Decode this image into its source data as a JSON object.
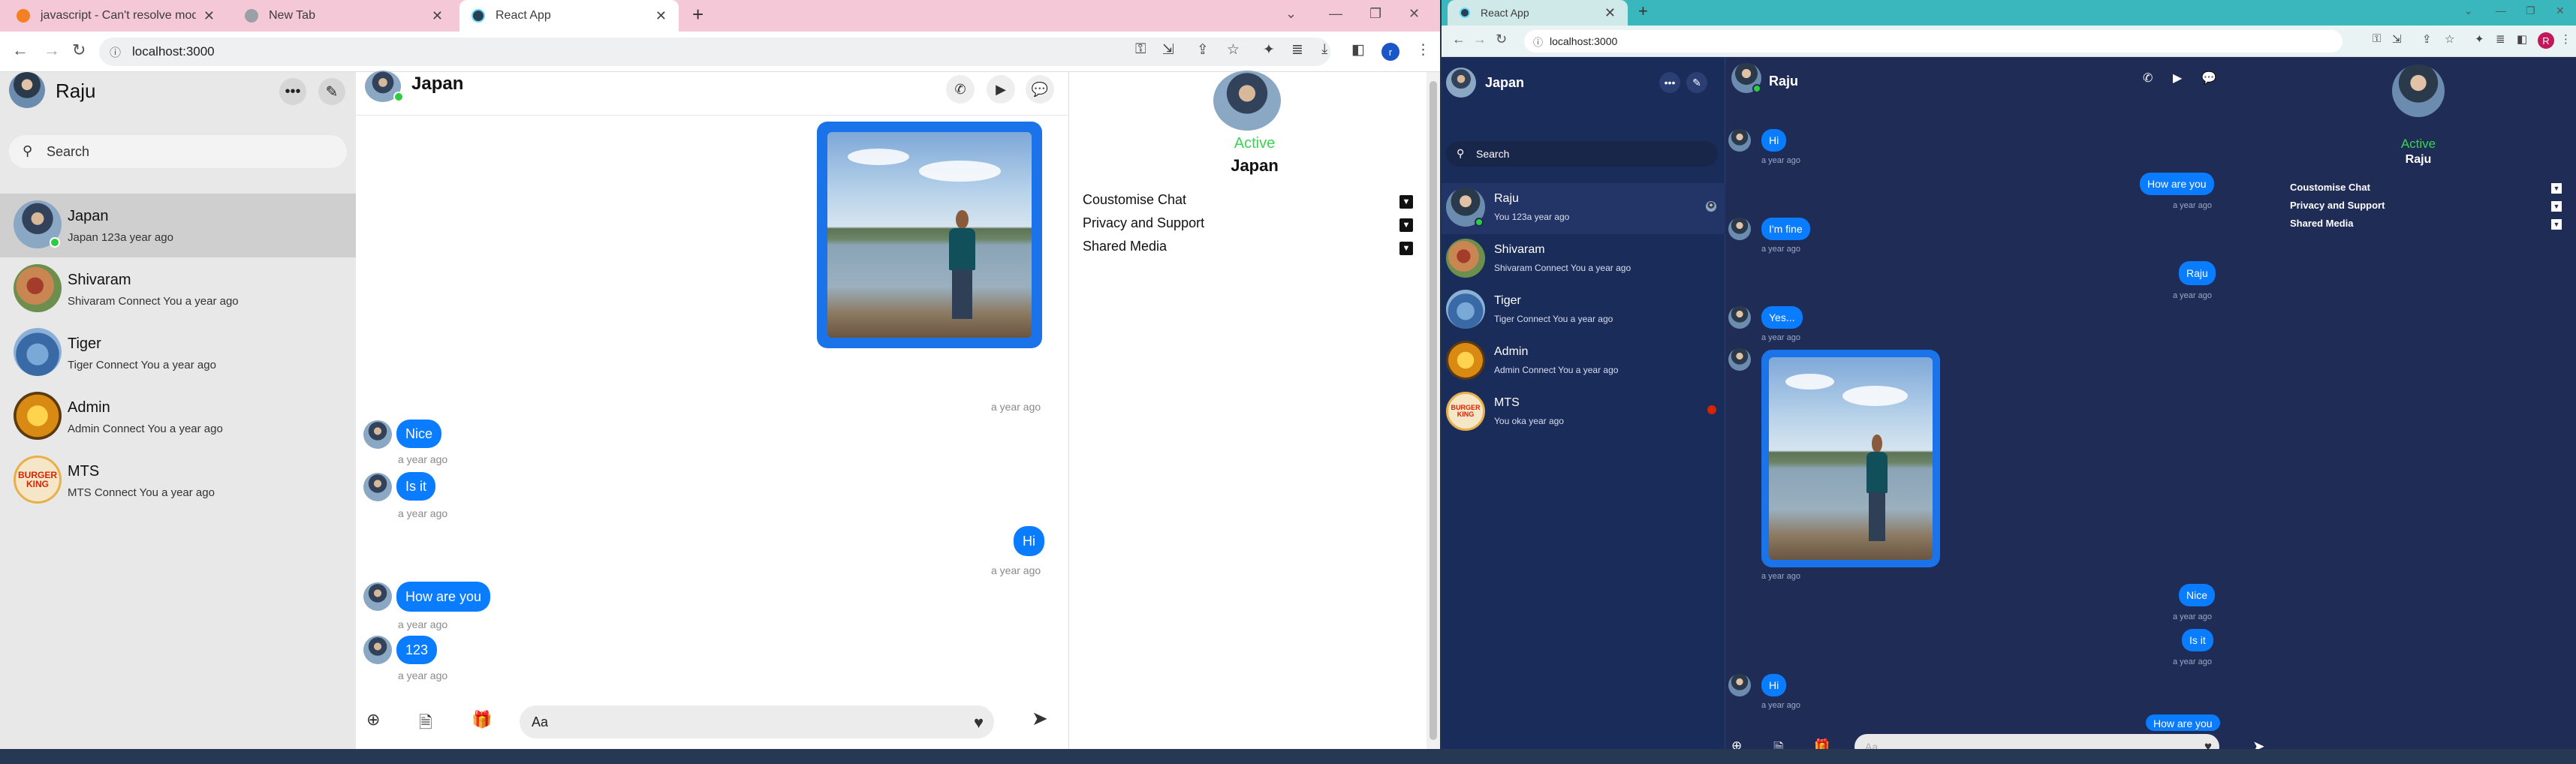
{
  "left_browser": {
    "tabs": [
      {
        "title": "javascript - Can't resolve module..."
      },
      {
        "title": "New Tab"
      },
      {
        "title": "React App"
      }
    ],
    "url": "localhost:3000",
    "profile_initial": "r"
  },
  "left_app": {
    "current_user": "Raju",
    "search_placeholder": "Search",
    "conversations": [
      {
        "name": "Japan",
        "preview": "Japan 123a year ago"
      },
      {
        "name": "Shivaram",
        "preview": "Shivaram Connect You a year ago"
      },
      {
        "name": "Tiger",
        "preview": "Tiger Connect You a year ago"
      },
      {
        "name": "Admin",
        "preview": "Admin Connect You a year ago"
      },
      {
        "name": "MTS",
        "preview": "MTS Connect You a year ago"
      }
    ],
    "mts_logo_text": "BURGER KING",
    "chat_title": "Japan",
    "messages": [
      {
        "ts": "a year ago"
      },
      {
        "text": "Nice",
        "ts": "a year ago"
      },
      {
        "text": "Is it",
        "ts": "a year ago"
      },
      {
        "text": "Hi",
        "ts": "a year ago"
      },
      {
        "text": "How are you",
        "ts": "a year ago"
      },
      {
        "text": "123",
        "ts": "a year ago"
      }
    ],
    "input_placeholder": "Aa",
    "info": {
      "status": "Active",
      "name": "Japan",
      "sections": [
        "Coustomise Chat",
        "Privacy and Support",
        "Shared Media"
      ]
    }
  },
  "right_browser": {
    "tab_title": "React App",
    "url": "localhost:3000",
    "profile_initial": "R"
  },
  "right_app": {
    "current_user": "Japan",
    "search_placeholder": "Search",
    "conversations": [
      {
        "name": "Raju",
        "preview": "You 123a year ago"
      },
      {
        "name": "Shivaram",
        "preview": "Shivaram Connect You a year ago"
      },
      {
        "name": "Tiger",
        "preview": "Tiger Connect You a year ago"
      },
      {
        "name": "Admin",
        "preview": "Admin Connect You a year ago"
      },
      {
        "name": "MTS",
        "preview": "You oka year ago"
      }
    ],
    "chat_title": "Raju",
    "messages": [
      {
        "text": "Hi",
        "ts": "a year ago"
      },
      {
        "text": "How are you",
        "ts": "a year ago"
      },
      {
        "text": "I'm fine",
        "ts": "a year ago"
      },
      {
        "text": "Raju",
        "ts": "a year ago"
      },
      {
        "text": "Yes...",
        "ts": "a year ago"
      },
      {
        "ts": "a year ago"
      },
      {
        "text": "Nice",
        "ts": "a year ago"
      },
      {
        "text": "Is it",
        "ts": "a year ago"
      },
      {
        "text": "Hi",
        "ts": "a year ago"
      },
      {
        "text": "How are you"
      }
    ],
    "input_placeholder": "Aa",
    "info": {
      "status": "Active",
      "name": "Raju",
      "sections": [
        "Coustomise Chat",
        "Privacy and Support",
        "Shared Media"
      ]
    }
  },
  "colors": {
    "bubble": "#0a7cff",
    "active": "#39d353",
    "dark_bg": "#1f2c56"
  }
}
